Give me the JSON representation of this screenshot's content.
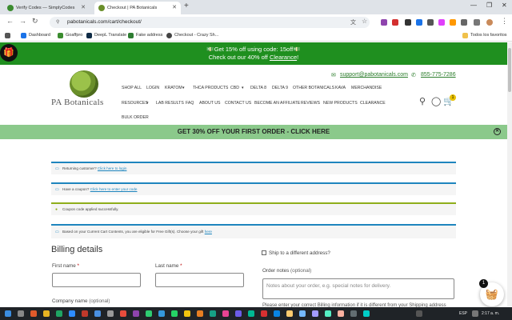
{
  "browser": {
    "tabs": [
      {
        "title": "Verify Codes — SimplyCodes",
        "active": false
      },
      {
        "title": "Checkout | PA Botanicals",
        "active": true
      }
    ],
    "url": "pabotanicals.com/cart/checkout/",
    "bookmarks": [
      "Dashboard",
      "Goaffpro",
      "DeepL Translate",
      "Fake address",
      "Checkout - Crazy Sh..."
    ],
    "all_bookmarks": "Todos los favoritos"
  },
  "promo": {
    "line1": "💵Get 15% off using code: 15off💵",
    "line2_prefix": "Check out our 40% off ",
    "line2_link": "Clearance",
    "line2_suffix": "!"
  },
  "header": {
    "logo": "PA Botanicals",
    "email": "support@pabotanicals.com",
    "phone": "855-775-7286",
    "cart_count": "1",
    "nav_row1": [
      "SHOP ALL",
      "LOGIN",
      "KRATOM",
      "THCA PRODUCTS",
      "CBD",
      "DELTA 8",
      "DELTA 9",
      "OTHER BOTANICALS",
      "KAVA",
      "MERCHANDISE"
    ],
    "nav_row2": [
      "RESOURCES",
      "LAB RESULTS",
      "FAQ",
      "ABOUT US",
      "CONTACT US",
      "BECOME AN AFFILIATE",
      "REVIEWS",
      "NEW PRODUCTS",
      "CLEARANCE"
    ],
    "nav_row3": [
      "BULK ORDER"
    ]
  },
  "banner": {
    "text": "GET 30% OFF YOUR FIRST ORDER - CLICK HERE"
  },
  "notices": {
    "returning": {
      "text": "Returning customer? ",
      "link": "Click here to login"
    },
    "coupon": {
      "text": "Have a coupon? ",
      "link": "Click here to enter your code"
    },
    "applied": {
      "text": "Coupon code applied successfully."
    },
    "gift": {
      "text": "Based on your Current Cart Contents, you are eligible for Free Gift(s). Choose your gift ",
      "link": "here"
    }
  },
  "billing": {
    "title": "Billing details",
    "first_name": "First name",
    "last_name": "Last name",
    "required_mark": "*",
    "company": "Company name",
    "optional": "(optional)",
    "ship_different": "Ship to a different address?",
    "order_notes": "Order notes",
    "order_notes_placeholder": "Notes about your order, e.g. special notes for delivery.",
    "hint": "Please enter your correct Billing information if it is different from your Shipping address"
  },
  "floating_cart": {
    "count": "1"
  },
  "taskbar": {
    "lang": "ESP",
    "time": "2:17 a. m."
  }
}
